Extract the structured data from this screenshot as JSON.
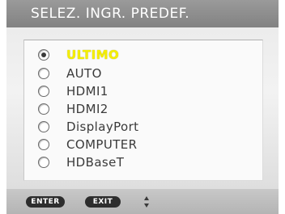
{
  "title": "SELEZ. INGR. PREDEF.",
  "options": [
    {
      "label": "ULTIMO",
      "checked": true,
      "highlighted": true
    },
    {
      "label": "AUTO",
      "checked": false,
      "highlighted": false
    },
    {
      "label": "HDMI1",
      "checked": false,
      "highlighted": false
    },
    {
      "label": "HDMI2",
      "checked": false,
      "highlighted": false
    },
    {
      "label": "DisplayPort",
      "checked": false,
      "highlighted": false
    },
    {
      "label": "COMPUTER",
      "checked": false,
      "highlighted": false
    },
    {
      "label": "HDBaseT",
      "checked": false,
      "highlighted": false
    }
  ],
  "footer": {
    "enter_label": "ENTER",
    "exit_label": "EXIT",
    "nav_icon": "up-down-arrows-icon"
  },
  "colors": {
    "highlight_text": "#f4ee00",
    "title_bg": "#8c8c8c",
    "key_bg": "#2d2d2d"
  }
}
